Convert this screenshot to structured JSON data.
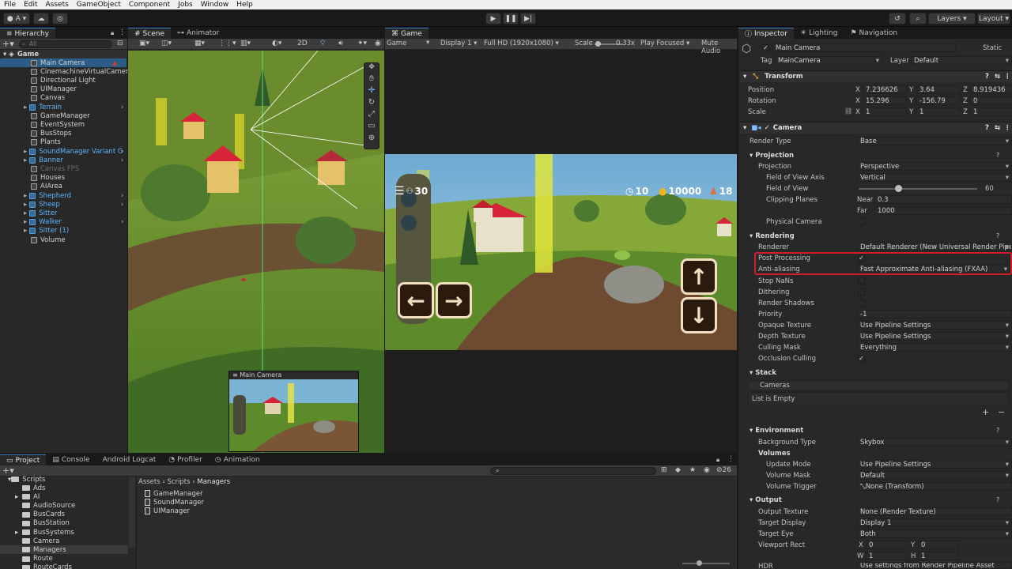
{
  "menu": [
    "File",
    "Edit",
    "Assets",
    "GameObject",
    "Component",
    "Jobs",
    "Window",
    "Help"
  ],
  "toolbar": {
    "account": "A",
    "layers": "Layers",
    "layout": "Layout"
  },
  "hierarchy": {
    "tab": "Hierarchy",
    "search_placeholder": "All",
    "scene_name": "Game",
    "items": [
      {
        "label": "Main Camera",
        "type": "object"
      },
      {
        "label": "CinemachineVirtualCamera",
        "type": "object"
      },
      {
        "label": "Directional Light",
        "type": "object"
      },
      {
        "label": "UIManager",
        "type": "object"
      },
      {
        "label": "Canvas",
        "type": "object"
      },
      {
        "label": "Terrain",
        "type": "prefab"
      },
      {
        "label": "GameManager",
        "type": "object"
      },
      {
        "label": "EventSystem",
        "type": "object"
      },
      {
        "label": "BusStops",
        "type": "object"
      },
      {
        "label": "Plants",
        "type": "object"
      },
      {
        "label": "SoundManager Variant G",
        "type": "prefab"
      },
      {
        "label": "Banner",
        "type": "prefab"
      },
      {
        "label": "Canvas FPS",
        "type": "disabled"
      },
      {
        "label": "Houses",
        "type": "object"
      },
      {
        "label": "AIArea",
        "type": "object"
      },
      {
        "label": "Shepherd",
        "type": "prefab"
      },
      {
        "label": "Sheep",
        "type": "prefab"
      },
      {
        "label": "Sitter",
        "type": "prefab"
      },
      {
        "label": "Walker",
        "type": "prefab"
      },
      {
        "label": "Sitter (1)",
        "type": "prefab"
      },
      {
        "label": "Volume",
        "type": "object"
      }
    ]
  },
  "scene": {
    "tabs": [
      "Scene",
      "Animator"
    ],
    "mode_2d": "2D",
    "camera_preview_title": "Main Camera"
  },
  "game": {
    "tab": "Game",
    "view_mode": "Game",
    "display": "Display 1",
    "resolution": "Full HD (1920x1080)",
    "scale_label": "Scale",
    "scale_value": "0.33x",
    "play_mode": "Play Focused",
    "mute": "Mute Audio",
    "hud": {
      "passengers": "30",
      "timer": "10",
      "coins": "10000",
      "people": "18"
    },
    "arrows": {
      "left": "←",
      "right": "→",
      "up": "↑",
      "down": "↓"
    }
  },
  "inspector": {
    "tabs": [
      "Inspector",
      "Lighting",
      "Navigation"
    ],
    "object_name": "Main Camera",
    "static_label": "Static",
    "tag_label": "Tag",
    "tag_value": "MainCamera",
    "layer_label": "Layer",
    "layer_value": "Default",
    "transform": {
      "title": "Transform",
      "position_label": "Position",
      "position": {
        "x": "7.236626",
        "y": "3.64",
        "z": "8.919436"
      },
      "rotation_label": "Rotation",
      "rotation": {
        "x": "15.296",
        "y": "-156.79",
        "z": "0"
      },
      "scale_label": "Scale",
      "scale": {
        "x": "1",
        "y": "1",
        "z": "1"
      }
    },
    "camera": {
      "title": "Camera",
      "render_type_label": "Render Type",
      "render_type": "Base",
      "projection_section": "Projection",
      "projection_label": "Projection",
      "projection": "Perspective",
      "fov_axis_label": "Field of View Axis",
      "fov_axis": "Vertical",
      "fov_label": "Field of View",
      "fov": "60",
      "fov_fraction": 0.33,
      "clipping_label": "Clipping Planes",
      "near_label": "Near",
      "near": "0.3",
      "far_label": "Far",
      "far": "1000",
      "physical_label": "Physical Camera",
      "rendering_section": "Rendering",
      "renderer_label": "Renderer",
      "renderer": "Default Renderer (New Universal Render Pipeli",
      "post_processing_label": "Post Processing",
      "antialiasing_label": "Anti-aliasing",
      "antialiasing": "Fast Approximate Anti-aliasing (FXAA)",
      "stop_nans_label": "Stop NaNs",
      "dithering_label": "Dithering",
      "render_shadows_label": "Render Shadows",
      "priority_label": "Priority",
      "priority": "-1",
      "opaque_label": "Opaque Texture",
      "opaque": "Use Pipeline Settings",
      "depth_label": "Depth Texture",
      "depth": "Use Pipeline Settings",
      "culling_label": "Culling Mask",
      "culling": "Everything",
      "occlusion_label": "Occlusion Culling",
      "stack_section": "Stack",
      "cameras_label": "Cameras",
      "list_empty": "List is Empty",
      "environment_section": "Environment",
      "bg_type_label": "Background Type",
      "bg_type": "Skybox",
      "volumes_label": "Volumes",
      "update_mode_label": "Update Mode",
      "update_mode": "Use Pipeline Settings",
      "volume_mask_label": "Volume Mask",
      "volume_mask": "Default",
      "volume_trigger_label": "Volume Trigger",
      "volume_trigger": "None (Transform)",
      "output_section": "Output",
      "output_texture_label": "Output Texture",
      "output_texture": "None (Render Texture)",
      "target_display_label": "Target Display",
      "target_display": "Display 1",
      "target_eye_label": "Target Eye",
      "target_eye": "Both",
      "viewport_label": "Viewport Rect",
      "viewport": {
        "x": "0",
        "y": "0",
        "w": "1",
        "h": "1"
      },
      "hdr_label": "HDR",
      "hdr": "Use settings from Render Pipeline Asset"
    }
  },
  "project": {
    "tabs": [
      "Project",
      "Console",
      "Android Logcat",
      "Profiler",
      "Animation"
    ],
    "tree_root": "Scripts",
    "folders": [
      "Ads",
      "AI",
      "AudioSource",
      "BusCards",
      "BusStation",
      "BusSystems",
      "Camera",
      "Managers",
      "Route",
      "RouteCards"
    ],
    "breadcrumb": [
      "Assets",
      "Scripts",
      "Managers"
    ],
    "files": [
      "GameManager",
      "SoundManager",
      "UIManager"
    ],
    "hidden_count": "26"
  },
  "colors": {
    "highlight_box": "#d01f2a",
    "accent": "#3a79bb",
    "prefab": "#5fb6ff"
  }
}
